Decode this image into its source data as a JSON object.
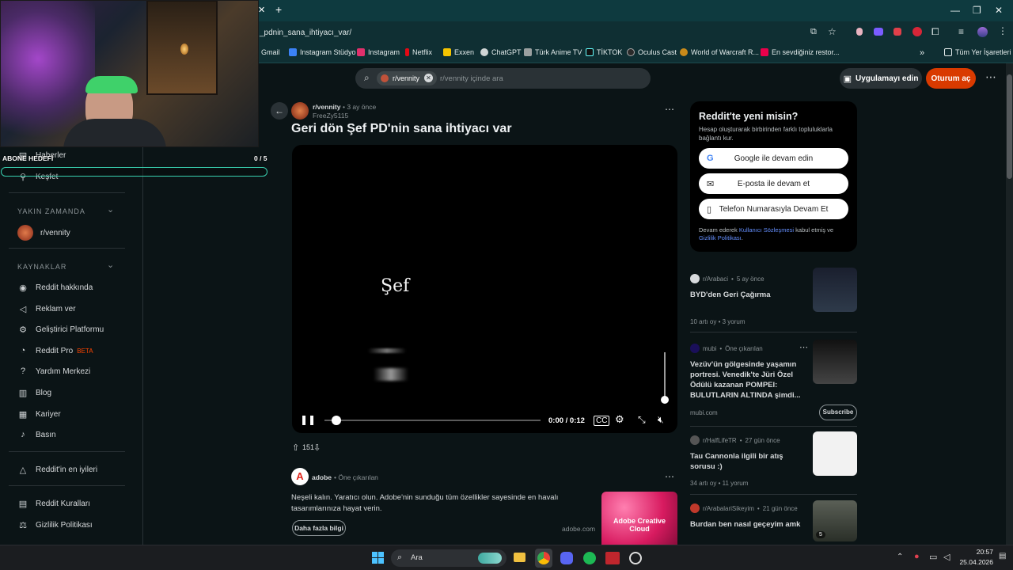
{
  "browser": {
    "address": "_pdnin_sana_ihtiyacı_var/",
    "bookmarks": [
      "Gmail",
      "Instagram Stüdyo",
      "Instagram",
      "Netflix",
      "Exxen",
      "ChatGPT",
      "Türk Anime TV",
      "TİKTOK",
      "Oculus Cast",
      "World of Warcraft R...",
      "En sevdiğiniz restor..."
    ],
    "all_bookmarks": "Tüm Yer İşaretleri"
  },
  "overlay": {
    "label": "ABONE HEDEFİ",
    "count": "0 / 5"
  },
  "header": {
    "subreddit_chip": "r/vennity",
    "search_placeholder": "r/vennity içinde ara",
    "get_app": "Uygulamayı edin",
    "login": "Oturum aç"
  },
  "sidebar": {
    "top_items": [
      "Haberler",
      "Keşfet"
    ],
    "recent_title": "YAKIN ZAMANDA",
    "recent_items": [
      "r/vennity"
    ],
    "resources_title": "KAYNAKLAR",
    "resources": [
      "Reddit hakkında",
      "Reklam ver",
      "Geliştirici Platformu",
      "Reddit Pro",
      "Yardım Merkezi",
      "Blog",
      "Kariyer",
      "Basın"
    ],
    "pro_badge": "BETA",
    "best": "Reddit'in en iyileri",
    "bottom": [
      "Reddit Kuralları",
      "Gizlilik Politikası"
    ]
  },
  "post": {
    "subreddit": "r/vennity",
    "age": "• 3 ay önce",
    "author": "FreeZy5115",
    "title": "Geri dön Şef PD'nin sana ihtiyacı var",
    "video_text": "Şef",
    "time": "0:00 / 0:12",
    "votes": "151"
  },
  "ad": {
    "advertiser": "adobe",
    "promoted": "Öne çıkarılan",
    "text": "Neşeli kalın. Yaratıcı olun. Adobe'nin sunduğu tüm özellikler sayesinde en havalı tasarımlarınıza hayat verin.",
    "button": "Daha fazla bilgi",
    "domain": "adobe.com",
    "image_text": "Adobe Creative Cloud"
  },
  "signup": {
    "title": "Reddit'te yeni misin?",
    "subtitle": "Hesap oluşturarak birbirinden farklı topluluklarla bağlantı kur.",
    "google": "Google ile devam edin",
    "email": "E-posta ile devam et",
    "phone": "Telefon Numarasıyla Devam Et",
    "terms_pre": "Devam ederek ",
    "terms_link": "Kullanıcı Sözleşmesi",
    "terms_mid": " kabul etmiş ve ",
    "privacy_link": "Gizlilik Politikası",
    "terms_end": "."
  },
  "related": [
    {
      "sub": "r/Arabaci",
      "age": "5 ay önce",
      "title": "BYD'den Geri Çağırma",
      "votes": "10 artı oy",
      "comments": "3 yorum"
    },
    {
      "sub": "mubi",
      "age": "Öne çıkarılan",
      "title": "Vezüv'ün gölgesinde yaşamın portresi. Venedik'te Jüri Özel Ödülü kazanan POMPEI: BULUTLARIN ALTINDA şimdi...",
      "domain": "mubi.com",
      "button": "Subscribe"
    },
    {
      "sub": "r/HalfLifeTR",
      "age": "27 gün önce",
      "title": "Tau Cannonla ilgili bir atış sorusu :)",
      "votes": "34 artı oy",
      "comments": "11 yorum"
    },
    {
      "sub": "r/ArabalariSikeyim",
      "age": "21 gün önce",
      "title": "Burdan ben nasıl geçeyim amk",
      "thumb_badge": "5"
    }
  ],
  "taskbar": {
    "search": "Ara",
    "time": "20:57",
    "date": "25.04.2026"
  },
  "colors": {
    "accent": "#d93a00",
    "page_bg": "#0b1416",
    "tab_bg": "#0e3a3f",
    "overlay_border": "#39d0b0"
  }
}
